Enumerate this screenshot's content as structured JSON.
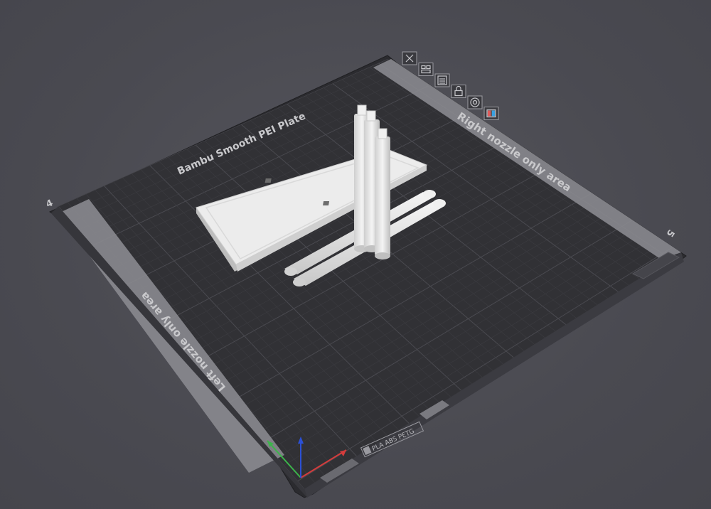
{
  "plate": {
    "name": "Bambu Smooth PEI Plate",
    "right_area_label": "Right nozzle only area",
    "left_area_label": "Left nozzle only area",
    "materials_label": "PLA ABS PETG",
    "number_left": "4",
    "number_right": "5"
  },
  "plate_toolbar": {
    "buttons": [
      {
        "name": "delete-plate-icon"
      },
      {
        "name": "auto-arrange-icon"
      },
      {
        "name": "plate-settings-icon"
      },
      {
        "name": "lock-plate-icon"
      },
      {
        "name": "plate-name-icon"
      },
      {
        "name": "filament-map-icon"
      }
    ]
  },
  "colors": {
    "background": "#4a4a51",
    "plate": "#2f2f33",
    "plate_edge": "#3c3c42",
    "nozzle_area": "#8a8a8f",
    "model": "#e6e6e6",
    "accent_green": "#00ae42",
    "axis_x": "#d43c3c",
    "axis_y": "#3cb44b",
    "axis_z": "#2b50d6"
  }
}
